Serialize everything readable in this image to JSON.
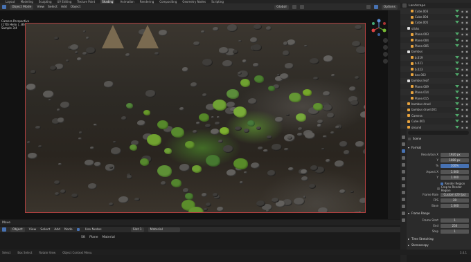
{
  "topbar": {
    "menus": [
      "Layout",
      "Modeling",
      "Sculpting",
      "UV Editing",
      "Texture Paint",
      "Shading",
      "Animation",
      "Rendering",
      "Compositing",
      "Geometry Nodes",
      "Scripting"
    ],
    "active_workspace": "Shading",
    "scene_label": "Landscape"
  },
  "viewport_header": {
    "mode": "Object Mode",
    "menus": [
      "View",
      "Select",
      "Add",
      "Object"
    ],
    "transform": "Global",
    "options": "Options"
  },
  "viewport_info": {
    "line1": "Camera Perspective",
    "line2": "(170) Helio | ..86",
    "line3": "Sample 3/4"
  },
  "outliner": {
    "rows": [
      {
        "name": "Cube.003",
        "indent": 2
      },
      {
        "name": "Cube.004",
        "indent": 2
      },
      {
        "name": "Cube.005",
        "indent": 2
      },
      {
        "name": "sticks",
        "indent": 1,
        "collection": true
      },
      {
        "name": "Plane.003",
        "indent": 2
      },
      {
        "name": "Plane.004",
        "indent": 2
      },
      {
        "name": "Plane.005",
        "indent": 2
      },
      {
        "name": "bambus",
        "indent": 1,
        "collection": true
      },
      {
        "name": "b.019",
        "indent": 2
      },
      {
        "name": "b.021",
        "indent": 2
      },
      {
        "name": "b.023",
        "indent": 2
      },
      {
        "name": "bas.002",
        "indent": 2
      },
      {
        "name": "bambus leaf",
        "indent": 1,
        "collection": true
      },
      {
        "name": "Plane.009",
        "indent": 2
      },
      {
        "name": "Plane.014",
        "indent": 2
      },
      {
        "name": "Plane.015",
        "indent": 2
      },
      {
        "name": "bambus druel",
        "indent": 1
      },
      {
        "name": "bambus druel.001",
        "indent": 1
      },
      {
        "name": "Camera",
        "indent": 1
      },
      {
        "name": "Cube.001",
        "indent": 1
      },
      {
        "name": "ground",
        "indent": 1
      },
      {
        "name": "Sun",
        "indent": 1
      }
    ]
  },
  "properties": {
    "scene": "Scene",
    "format_label": "Format",
    "resolution_x_label": "Resolution X",
    "resolution_x": "1920 px",
    "resolution_y_label": "Y",
    "resolution_y": "1080 px",
    "percent_label": "%",
    "percent": "100%",
    "aspect_x_label": "Aspect X",
    "aspect_x": "1.000",
    "aspect_y_label": "Y",
    "aspect_y": "1.000",
    "render_region": "Render Region",
    "crop_region": "Crop to Render Region",
    "frame_rate_label": "Frame Rate",
    "frame_rate": "Custom (20 fps)",
    "fps_label": "FPS",
    "fps": "20",
    "base_label": "Base",
    "base": "1.000",
    "frame_range_label": "Frame Range",
    "frame_start_label": "Frame Start",
    "frame_start": "1",
    "end_label": "End",
    "end": "250",
    "step_label": "Step",
    "step": "1",
    "time_stretching": "Time Stretching",
    "stereoscopy": "Stereoscopy"
  },
  "node_editor": {
    "header_label": "Move",
    "object_dropdown": "Object",
    "menus": [
      "View",
      "Select",
      "Add",
      "Node"
    ],
    "use_nodes": "Use Nodes",
    "slot": "Slot 1",
    "material": "Material",
    "breadcrumb": [
      "Sft",
      "Plane",
      "Material"
    ]
  },
  "statusbar": {
    "items": [
      "Select",
      "Box Select",
      "Rotate View",
      "Object Context Menu"
    ],
    "version": "3.4.1"
  },
  "colors": {
    "accent": "#4772b3",
    "collection_green": "#4fa86a",
    "render_border": "#b04040"
  }
}
